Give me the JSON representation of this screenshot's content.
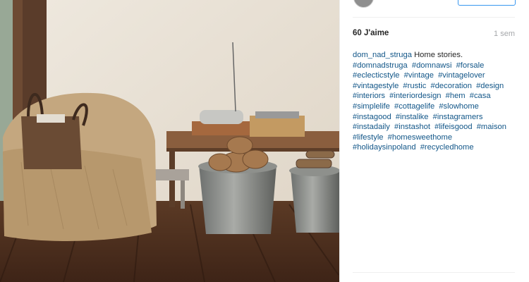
{
  "post": {
    "likes": "60 J'aime",
    "time": "1 sem",
    "username": "dom_nad_struga",
    "caption_text": "Home stories.",
    "hashtags": [
      "#domnadstruga",
      "#domnawsi",
      "#forsale",
      "#eclecticstyle",
      "#vintage",
      "#vintagelover",
      "#vintagestyle",
      "#rustic",
      "#decoration",
      "#design",
      "#interiors",
      "#interiordesign",
      "#hem",
      "#casa",
      "#simplelife",
      "#cottagelife",
      "#slowhome",
      "#instagood",
      "#instalike",
      "#instagramers",
      "#instadaily",
      "#instashot",
      "#lifeisgood",
      "#maison",
      "#lifestyle",
      "#homesweethome",
      "#holidaysinpoland",
      "#recycledhome"
    ]
  },
  "colors": {
    "link": "#125688",
    "text": "#262626",
    "muted": "#a5a7aa",
    "accent": "#3897f0"
  }
}
